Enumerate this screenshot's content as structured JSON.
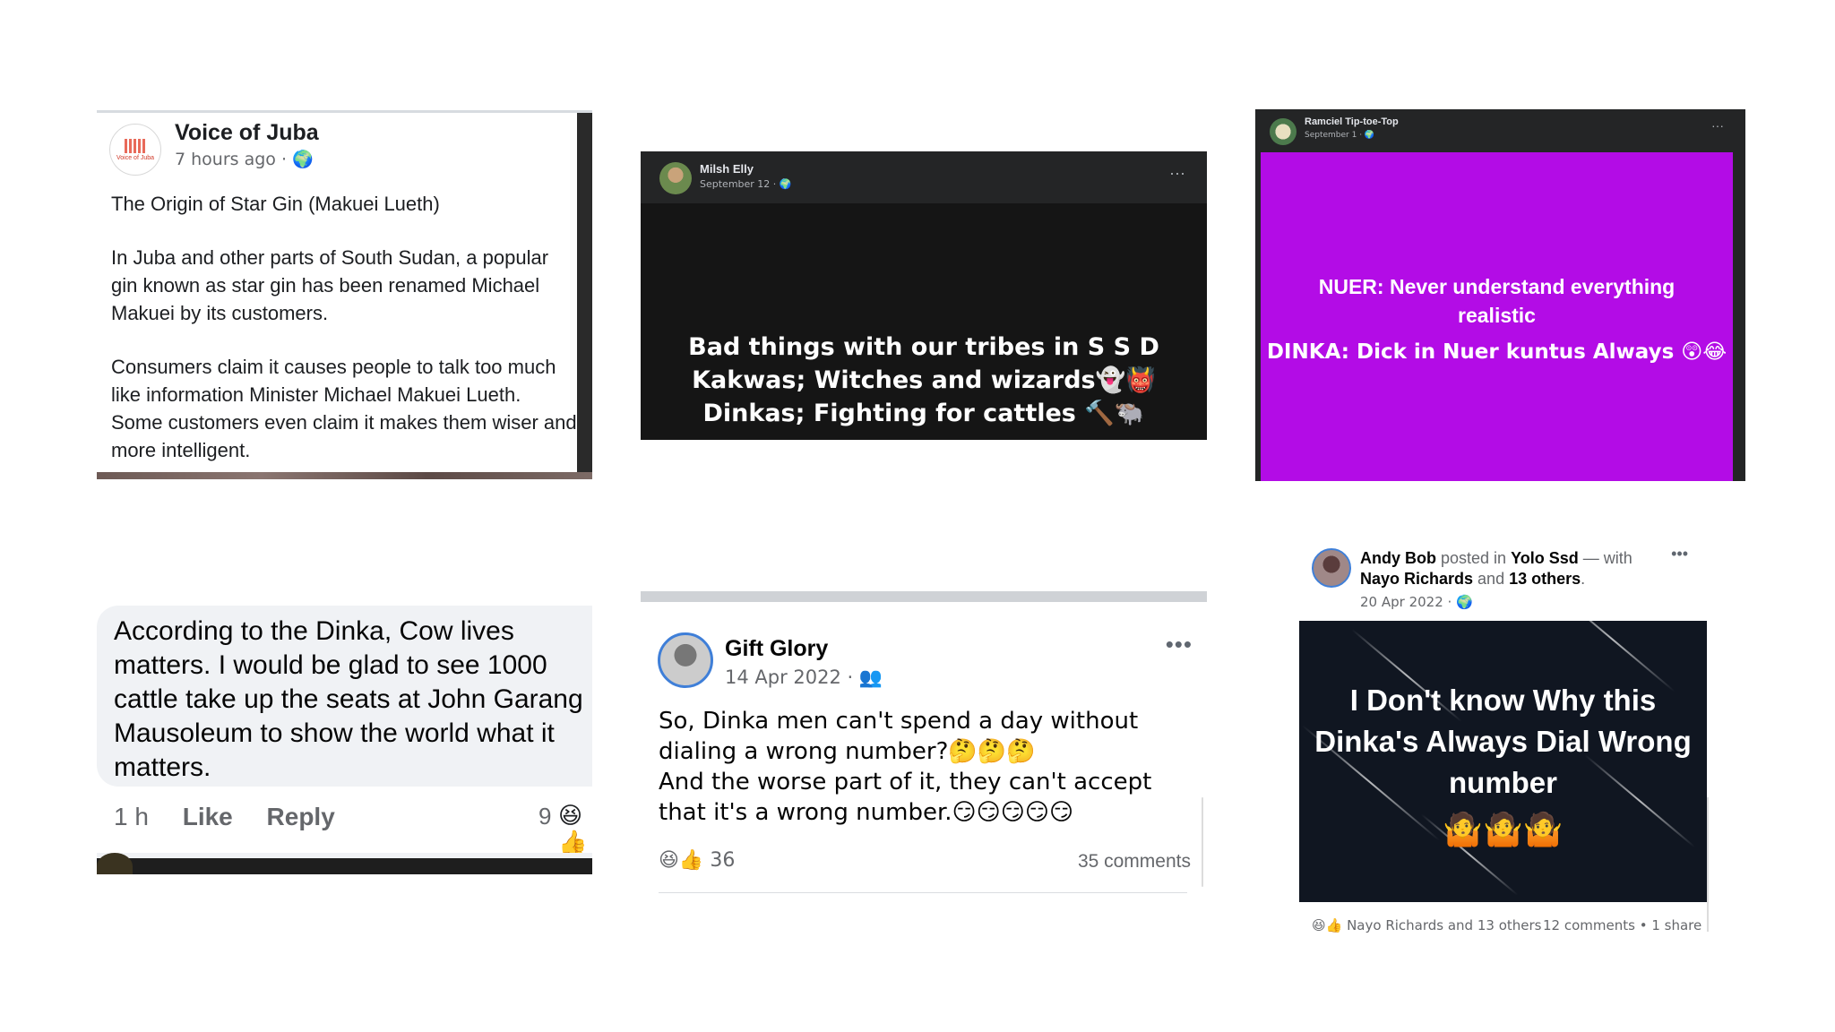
{
  "panel1": {
    "name": "Voice of Juba",
    "meta": "7 hours ago · 🌍",
    "avatar_text": "Voice of Juba",
    "title": "The Origin of Star Gin (Makuei Lueth)",
    "para1": "In Juba and other parts of South Sudan, a popular gin known as star gin has been renamed Michael Makuei by its customers.",
    "para2": "Consumers claim it causes people to talk too much like information Minister Michael Makuei Lueth. Some customers even claim it makes them wiser and more intelligent."
  },
  "panel2": {
    "name": "Milsh Elly",
    "meta": "September 12 · 🌍",
    "more": "···",
    "line1": "Bad things with our tribes in S S D",
    "line2": "Kakwas; Witches and wizards👻👹",
    "line3": "Dinkas; Fighting for cattles 🔨🐃"
  },
  "panel3": {
    "name": "Ramciel Tip-toe-Top",
    "meta": "September 1 · 🌍",
    "more": "···",
    "line1": "NUER: Never understand everything realistic",
    "line2": "DINKA: Dick in Nuer kuntus Always 😲😂"
  },
  "panel4": {
    "comment": "According  to the Dinka, Cow lives\nmatters. I would be glad to see 1000\ncattle take up the seats at John Garang\nMausoleum to show the world what it\nmatters.",
    "time": "1 h",
    "like": "Like",
    "reply": "Reply",
    "count": "9",
    "reacts": "😆👍"
  },
  "panel5": {
    "name": "Gift Glory",
    "meta": "14 Apr 2022 · 👥",
    "more": "•••",
    "body1": "So, Dinka men can't spend a day without dialing a wrong number?🤔🤔🤔",
    "body2": "And the worse part of it, they can't accept that it's a wrong number.😏😏😏😏😏",
    "reacts": "😆👍 36",
    "comments": "35 comments"
  },
  "panel6": {
    "author": "Andy Bob",
    "posted_in": " posted in ",
    "group": "Yolo Ssd",
    "with": " — with ",
    "tagged": "Nayo Richards",
    "and": " and ",
    "others": "13 others",
    "meta": "20 Apr 2022 · 🌍",
    "more": "•••",
    "image_text": "I Don't know Why this Dinka's Always Dial Wrong number",
    "image_emojis": "🤷🤷🤷",
    "footer_left": "😆👍 Nayo Richards and 13 others",
    "footer_right": "12 comments • 1 share"
  }
}
